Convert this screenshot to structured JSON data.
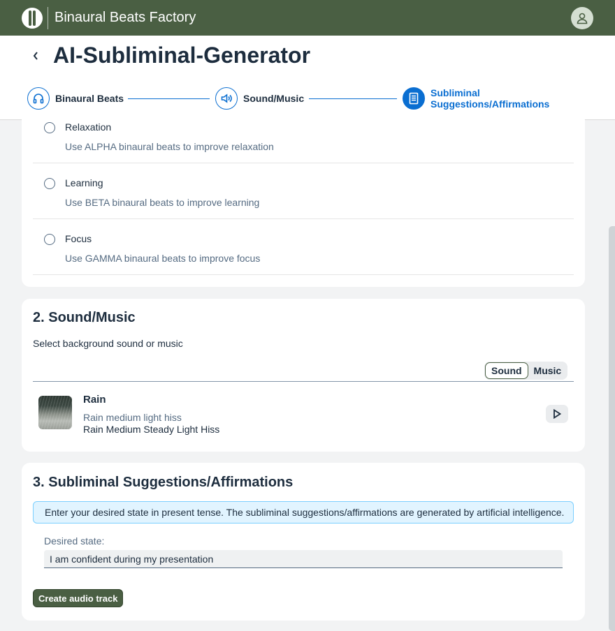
{
  "shell": {
    "title": "Binaural Beats Factory"
  },
  "header": {
    "title": "AI-Subliminal-Generator"
  },
  "steps": [
    {
      "label": "Binaural Beats",
      "icon": "headphones-icon"
    },
    {
      "label": "Sound/Music",
      "icon": "speaker-icon"
    },
    {
      "label_line1": "Subliminal",
      "label_line2": "Suggestions/Affirmations",
      "icon": "document-icon",
      "active": true
    }
  ],
  "goals": [
    {
      "title": "Relaxation",
      "description": "Use ALPHA binaural beats to improve relaxation"
    },
    {
      "title": "Learning",
      "description": "Use BETA binaural beats to improve learning"
    },
    {
      "title": "Focus",
      "description": "Use GAMMA binaural beats to improve focus"
    }
  ],
  "sound": {
    "title": "2. Sound/Music",
    "subtitle": "Select background sound or music",
    "segments": [
      "Sound",
      "Music"
    ],
    "selected_segment": "Sound",
    "track": {
      "title": "Rain",
      "subtitle": "Rain medium light hiss",
      "description": "Rain Medium Steady Light Hiss"
    }
  },
  "subliminal": {
    "title": "3. Subliminal Suggestions/Affirmations",
    "info": "Enter your desired state in present tense. The subliminal suggestions/affirmations are generated by artificial intelligence.",
    "field_label": "Desired state:",
    "field_value": "I am confident during my presentation",
    "button_label": "Create audio track"
  },
  "colors": {
    "brand": "#4a5f43",
    "accent": "#0a6ed1",
    "info_bg": "#e1f4ff"
  }
}
